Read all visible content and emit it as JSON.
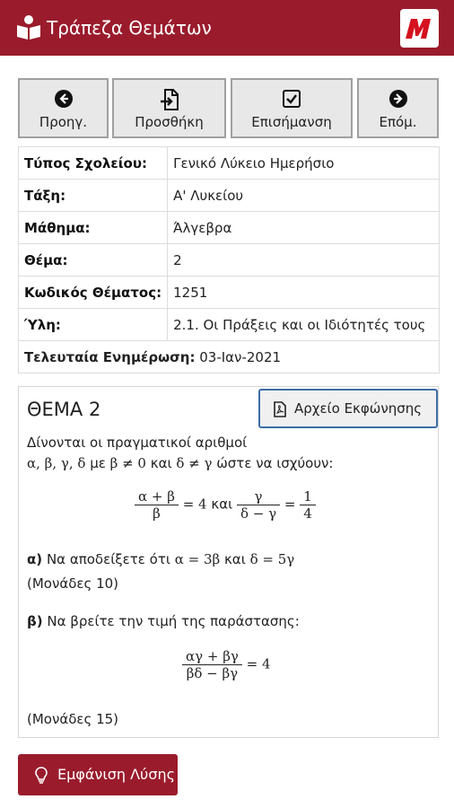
{
  "app": {
    "title": "Τράπεζα Θεμάτων"
  },
  "toolbar": {
    "prev": "Προηγ.",
    "add": "Προσθήκη",
    "mark": "Επισήμανση",
    "next": "Επόμ."
  },
  "info": [
    {
      "key": "Τύπος Σχολείου:",
      "value": "Γενικό Λύκειο Ημερήσιο"
    },
    {
      "key": "Τάξη:",
      "value": "Α' Λυκείου"
    },
    {
      "key": "Μάθημα:",
      "value": "Άλγεβρα"
    },
    {
      "key": "Θέμα:",
      "value": "2"
    },
    {
      "key": "Κωδικός Θέματος:",
      "value": "1251"
    },
    {
      "key": "Ύλη:",
      "value": "2.1. Οι Πράξεις και οι Ιδιότητές τους"
    },
    {
      "key": "Τελευταία Ενημέρωση:",
      "value": "03-Ιαν-2021"
    }
  ],
  "problem": {
    "title": "ΘΕΜΑ 2",
    "file_button": "Αρχείο Εκφώνησης",
    "intro": "Δίνονται οι πραγματικοί αριθμοί",
    "cond_vars": "α, β, γ, δ",
    "cond_me": "με",
    "cond_1": "β ≠ 0",
    "cond_kai": "και",
    "cond_2": "δ ≠ γ",
    "cond_tail": "ώστε να ισχύουν:",
    "eq1_num1": "α + β",
    "eq1_den1": "β",
    "eq1_eq": "= 4",
    "eq1_kai": "και",
    "eq1_num2": "γ",
    "eq1_den2": "δ − γ",
    "eq1_eq2": "=",
    "eq1_num3": "1",
    "eq1_den3": "4",
    "a_label": "α)",
    "a_text": "Να αποδείξετε ότι",
    "a_m1": "α = 3β",
    "a_kai": "και",
    "a_m2": "δ = 5γ",
    "a_points": "(Μονάδες 10)",
    "b_label": "β)",
    "b_text": "Να βρείτε την τιμή της παράστασης:",
    "eq2_num": "αγ + βγ",
    "eq2_den": "βδ − βγ",
    "eq2_eq": "= 4",
    "b_points": "(Μονάδες 15)"
  },
  "solution_button": "Εμφάνιση Λύσης",
  "colors": {
    "brand": "#9a1b2c",
    "button_border": "#3d6ea6"
  },
  "icons": {
    "app": "book-reader-icon",
    "prev": "arrow-left-circle-icon",
    "add": "file-import-icon",
    "mark": "checkbox-icon",
    "next": "arrow-right-circle-icon",
    "file": "pdf-file-icon",
    "solution": "lightbulb-icon"
  }
}
